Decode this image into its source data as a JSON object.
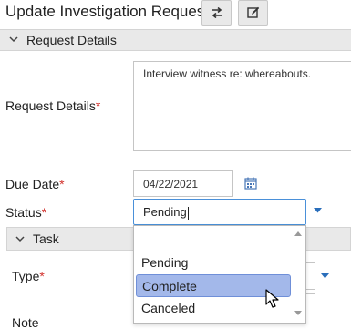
{
  "window": {
    "title": "Update Investigation Request"
  },
  "toolbar": {
    "swap_icon": "swap-arrows-icon",
    "edit_icon": "edit-icon"
  },
  "sections": {
    "request_details": {
      "label": "Request Details"
    },
    "task": {
      "label": "Task"
    }
  },
  "fields": {
    "request_details": {
      "label": "Request Details",
      "required_marker": "*",
      "value": "Interview witness re: whereabouts."
    },
    "due_date": {
      "label": "Due Date",
      "required_marker": "*",
      "value": "04/22/2021"
    },
    "status": {
      "label": "Status",
      "required_marker": "*",
      "value": "Pending",
      "options": [
        "",
        "Pending",
        "Complete",
        "Canceled"
      ],
      "highlighted": "Complete"
    },
    "type": {
      "label": "Type",
      "required_marker": "*"
    },
    "note": {
      "label": "Note"
    }
  },
  "colors": {
    "highlight": "#a3b8ea",
    "focus_border": "#4a90d9",
    "required": "#d2322d",
    "accent_arrow": "#2a6ebb"
  }
}
